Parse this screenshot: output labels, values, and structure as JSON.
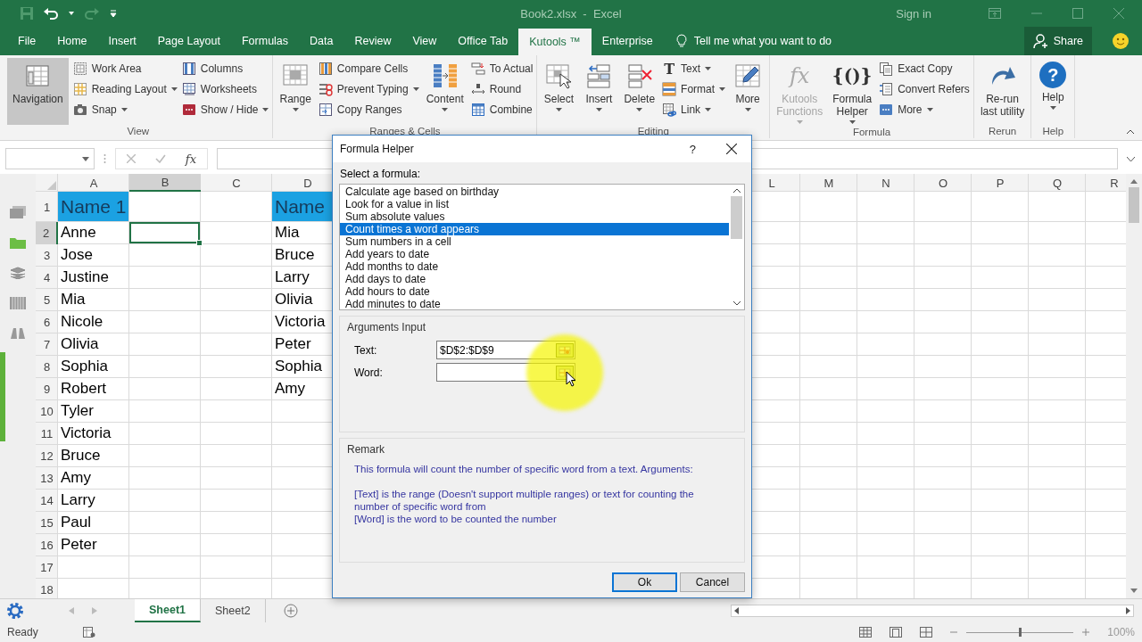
{
  "window": {
    "title": "Book2.xlsx  -  Excel",
    "sign_in": "Sign in"
  },
  "ribbon_tabs": [
    {
      "label": "File",
      "selected": false
    },
    {
      "label": "Home",
      "selected": false
    },
    {
      "label": "Insert",
      "selected": false
    },
    {
      "label": "Page Layout",
      "selected": false
    },
    {
      "label": "Formulas",
      "selected": false
    },
    {
      "label": "Data",
      "selected": false
    },
    {
      "label": "Review",
      "selected": false
    },
    {
      "label": "View",
      "selected": false
    },
    {
      "label": "Office Tab",
      "selected": false
    },
    {
      "label": "Kutools ™",
      "selected": true
    },
    {
      "label": "Enterprise",
      "selected": false
    }
  ],
  "tell_me": {
    "placeholder": "Tell me what you want to do"
  },
  "share_button": "Share",
  "ribbon_groups": [
    {
      "label": "View",
      "columns": [
        {
          "kind": "large",
          "items": [
            {
              "label": "Navigation",
              "caret": false,
              "on": true
            }
          ]
        },
        {
          "kind": "stack",
          "items": [
            {
              "label": "Work Area",
              "caret": false
            },
            {
              "label": "Reading Layout",
              "caret": true
            },
            {
              "label": "Snap",
              "caret": true
            }
          ]
        },
        {
          "kind": "stack",
          "items": [
            {
              "label": "Columns",
              "caret": false
            },
            {
              "label": "Worksheets",
              "caret": false
            },
            {
              "label": "Show / Hide",
              "caret": true
            }
          ]
        }
      ]
    },
    {
      "label": "Ranges & Cells",
      "columns": [
        {
          "kind": "large",
          "items": [
            {
              "label": "Range",
              "caret": true
            }
          ]
        },
        {
          "kind": "stack",
          "items": [
            {
              "label": "Compare Cells",
              "caret": false
            },
            {
              "label": "Prevent Typing",
              "caret": true
            },
            {
              "label": "Copy Ranges",
              "caret": false
            }
          ]
        },
        {
          "kind": "large",
          "items": [
            {
              "label": "Content",
              "caret": true
            }
          ]
        },
        {
          "kind": "stack",
          "items": [
            {
              "label": "To Actual",
              "caret": false
            },
            {
              "label": "Round",
              "caret": false
            },
            {
              "label": "Combine",
              "caret": false
            }
          ]
        }
      ]
    },
    {
      "label": "Editing",
      "columns": [
        {
          "kind": "large",
          "items": [
            {
              "label": "Select",
              "caret": true
            }
          ]
        },
        {
          "kind": "large",
          "items": [
            {
              "label": "Insert",
              "caret": true
            }
          ]
        },
        {
          "kind": "large",
          "items": [
            {
              "label": "Delete",
              "caret": true
            }
          ]
        },
        {
          "kind": "stack",
          "items": [
            {
              "label": "Text",
              "caret": true,
              "glyph": {
                "text": "T",
                "kind": "serif"
              }
            },
            {
              "label": "Format",
              "caret": true
            },
            {
              "label": "Link",
              "caret": true
            }
          ]
        },
        {
          "kind": "large",
          "items": [
            {
              "label": "More",
              "caret": true
            }
          ]
        }
      ]
    },
    {
      "label": "Formula",
      "columns": [
        {
          "kind": "large",
          "items": [
            {
              "label": "Kutools\nFunctions",
              "caret": true,
              "disabled": true,
              "glyph": {
                "text": "fx",
                "kind": "italic"
              }
            }
          ]
        },
        {
          "kind": "large",
          "items": [
            {
              "label": "Formula\nHelper",
              "caret": true,
              "disabled": false,
              "glyph": {
                "text": "{()}",
                "kind": "serif"
              }
            }
          ]
        },
        {
          "kind": "stack",
          "items": [
            {
              "label": "Exact Copy",
              "caret": false
            },
            {
              "label": "Convert Refers",
              "caret": false
            },
            {
              "label": "More",
              "caret": true
            }
          ]
        }
      ]
    },
    {
      "label": "Rerun",
      "columns": [
        {
          "kind": "large",
          "items": [
            {
              "label": "Re-run\nlast utility",
              "caret": false
            }
          ]
        }
      ]
    },
    {
      "label": "Help",
      "columns": [
        {
          "kind": "large",
          "items": [
            {
              "label": "Help",
              "caret": true,
              "glyph": {
                "text": "?",
                "kind": "badge"
              }
            }
          ]
        }
      ]
    }
  ],
  "formula_bar": {
    "function_label": "fx"
  },
  "columns": [
    {
      "label": "A",
      "selected": false
    },
    {
      "label": "B",
      "selected": true
    },
    {
      "label": "C",
      "selected": false
    },
    {
      "label": "D",
      "selected": false
    },
    {
      "label": "L",
      "selected": false
    },
    {
      "label": "M",
      "selected": false
    },
    {
      "label": "N",
      "selected": false
    },
    {
      "label": "O",
      "selected": false
    },
    {
      "label": "P",
      "selected": false
    },
    {
      "label": "Q",
      "selected": false
    },
    {
      "label": "R",
      "selected": false
    }
  ],
  "rows": [
    {
      "num": "1",
      "a": "Name 1",
      "d": "Name",
      "highlighted": true,
      "selected": false
    },
    {
      "num": "2",
      "a": "Anne",
      "d": "Mia",
      "highlighted": false,
      "selected": true
    },
    {
      "num": "3",
      "a": "Jose",
      "d": "Bruce",
      "highlighted": false,
      "selected": false
    },
    {
      "num": "4",
      "a": "Justine",
      "d": "Larry",
      "highlighted": false,
      "selected": false
    },
    {
      "num": "5",
      "a": "Mia",
      "d": "Olivia",
      "highlighted": false,
      "selected": false
    },
    {
      "num": "6",
      "a": "Nicole",
      "d": "Victoria",
      "highlighted": false,
      "selected": false
    },
    {
      "num": "7",
      "a": "Olivia",
      "d": "Peter",
      "highlighted": false,
      "selected": false
    },
    {
      "num": "8",
      "a": "Sophia",
      "d": "Sophia",
      "highlighted": false,
      "selected": false
    },
    {
      "num": "9",
      "a": "Robert",
      "d": "Amy",
      "highlighted": false,
      "selected": false
    },
    {
      "num": "10",
      "a": "Tyler",
      "highlighted": false,
      "selected": false
    },
    {
      "num": "11",
      "a": "Victoria",
      "highlighted": false,
      "selected": false
    },
    {
      "num": "12",
      "a": "Bruce",
      "highlighted": false,
      "selected": false
    },
    {
      "num": "13",
      "a": "Amy",
      "highlighted": false,
      "selected": false
    },
    {
      "num": "14",
      "a": "Larry",
      "highlighted": false,
      "selected": false
    },
    {
      "num": "15",
      "a": "Paul",
      "highlighted": false,
      "selected": false
    },
    {
      "num": "16",
      "a": "Peter",
      "highlighted": false,
      "selected": false
    },
    {
      "num": "17",
      "selected": false
    },
    {
      "num": "18",
      "selected": false
    }
  ],
  "sheet_tabs": [
    {
      "label": "Sheet1",
      "selected": true
    },
    {
      "label": "Sheet2",
      "selected": false
    }
  ],
  "status_bar": {
    "status": "Ready",
    "zoom": "100%",
    "zoom_slider": {
      "level": 0.5
    }
  },
  "dialog": {
    "title": "Formula Helper",
    "help": "?",
    "select_label": "Select a formula:",
    "formulas": [
      {
        "label": "Calculate age based on birthday",
        "selected": false
      },
      {
        "label": "Look for a value in list",
        "selected": false
      },
      {
        "label": "Sum absolute values",
        "selected": false
      },
      {
        "label": "Count times a word appears",
        "selected": true
      },
      {
        "label": "Sum numbers in a cell",
        "selected": false
      },
      {
        "label": "Add years to date",
        "selected": false
      },
      {
        "label": "Add months to date",
        "selected": false
      },
      {
        "label": "Add days to date",
        "selected": false
      },
      {
        "label": "Add hours to date",
        "selected": false
      },
      {
        "label": "Add minutes to date",
        "selected": false
      }
    ],
    "arguments_title": "Arguments Input",
    "arguments": [
      {
        "label": "Text:",
        "value": "$D$2:$D$9"
      },
      {
        "label": "Word:"
      }
    ],
    "remark_title": "Remark",
    "remark": [
      "This formula will count the number of specific word from a text. Arguments:",
      "[Text] is the range (Doesn't support multiple ranges) or text for counting the number of specific word from",
      "[Word] is the word to be counted the number"
    ],
    "buttons": [
      {
        "label": "Ok",
        "default": true
      },
      {
        "label": "Cancel",
        "default": false
      }
    ]
  }
}
